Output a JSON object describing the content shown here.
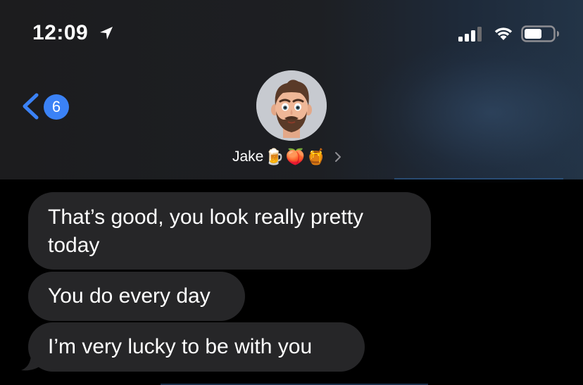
{
  "status_bar": {
    "time": "12:09"
  },
  "nav": {
    "unread_count": "6"
  },
  "contact": {
    "name": "Jake",
    "emojis": [
      "🍺",
      "🍑",
      "🍯"
    ]
  },
  "messages": [
    {
      "text": "That’s good, you look really pretty today"
    },
    {
      "text": "You do every day"
    },
    {
      "text": "I’m very lucky to be with you"
    }
  ],
  "colors": {
    "accent": "#3b82f6",
    "bubble": "#262628",
    "header": "#1c1c1e"
  },
  "icons": {
    "location": "location-arrow-icon",
    "signal": "cellular-signal-icon",
    "wifi": "wifi-icon",
    "battery": "battery-icon",
    "back": "chevron-left-icon",
    "contact_details": "chevron-right-icon"
  }
}
